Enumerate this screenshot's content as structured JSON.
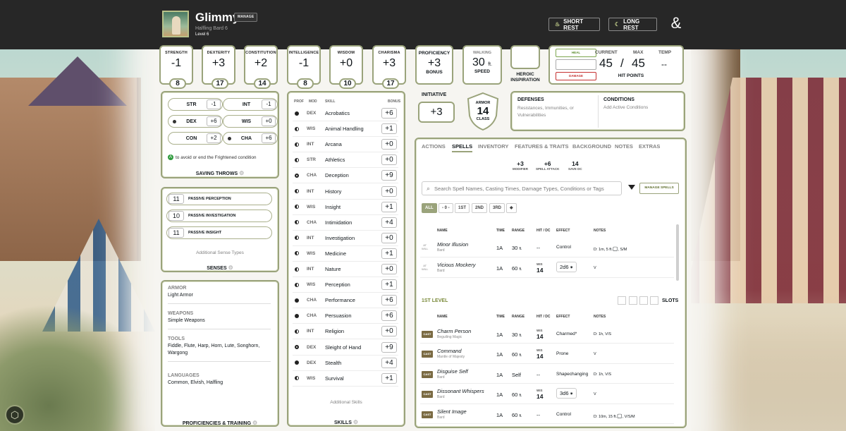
{
  "header": {
    "name": "Glimmy",
    "manage_label": "MANAGE",
    "subtitle": "Halfling  Bard 6",
    "level": "Level 6",
    "short_rest": "SHORT REST",
    "long_rest": "LONG REST"
  },
  "abilities": [
    {
      "label": "STRENGTH",
      "mod": "-1",
      "score": "8"
    },
    {
      "label": "DEXTERITY",
      "mod": "+3",
      "score": "17"
    },
    {
      "label": "CONSTITUTION",
      "mod": "+2",
      "score": "14"
    },
    {
      "label": "INTELLIGENCE",
      "mod": "-1",
      "score": "8"
    },
    {
      "label": "WISDOM",
      "mod": "+0",
      "score": "10"
    },
    {
      "label": "CHARISMA",
      "mod": "+3",
      "score": "17"
    }
  ],
  "proficiency": {
    "title": "PROFICIENCY",
    "value": "+3",
    "sub": "BONUS"
  },
  "speed": {
    "title": "WALKING",
    "value": "30",
    "unit": "ft.",
    "sub": "SPEED"
  },
  "inspiration": {
    "label1": "HEROIC",
    "label2": "INSPIRATION"
  },
  "hp": {
    "heal": "HEAL",
    "damage": "DAMAGE",
    "current_label": "CURRENT",
    "max_label": "MAX",
    "temp_label": "TEMP",
    "current": "45",
    "slash": "/",
    "max": "45",
    "temp": "--",
    "footer": "HIT POINTS"
  },
  "initiative": {
    "title": "INITIATIVE",
    "value": "+3"
  },
  "armor": {
    "top": "ARMOR",
    "value": "14",
    "bottom": "CLASS"
  },
  "defenses": {
    "title": "DEFENSES",
    "text": "Resistances, Immunities, or Vulnerabilities"
  },
  "conditions": {
    "title": "CONDITIONS",
    "text": "Add Active Conditions"
  },
  "saves": {
    "items": [
      {
        "ab": "STR",
        "val": "-1",
        "prof": false
      },
      {
        "ab": "INT",
        "val": "-1",
        "prof": false
      },
      {
        "ab": "DEX",
        "val": "+6",
        "prof": true
      },
      {
        "ab": "WIS",
        "val": "+0",
        "prof": false
      },
      {
        "ab": "CON",
        "val": "+2",
        "prof": false
      },
      {
        "ab": "CHA",
        "val": "+6",
        "prof": true
      }
    ],
    "note_icon": "A",
    "note": "to avoid or end the Frightened condition",
    "title": "SAVING THROWS"
  },
  "senses": {
    "items": [
      {
        "num": "11",
        "label": "PASSIVE PERCEPTION"
      },
      {
        "num": "10",
        "label": "PASSIVE INVESTIGATION"
      },
      {
        "num": "11",
        "label": "PASSIVE INSIGHT"
      }
    ],
    "additional": "Additional Sense Types",
    "title": "SENSES"
  },
  "proficiencies": {
    "sections": [
      {
        "h": "ARMOR",
        "t": "Light Armor"
      },
      {
        "h": "WEAPONS",
        "t": "Simple Weapons"
      },
      {
        "h": "TOOLS",
        "t": "Fiddle, Flute, Harp, Horn, Lute, Songhorn, Wargong"
      },
      {
        "h": "LANGUAGES",
        "t": "Common, Elvish, Halfling"
      }
    ],
    "title": "PROFICIENCIES & TRAINING"
  },
  "skills": {
    "headers": {
      "prof": "PROF",
      "mod": "MOD",
      "skill": "SKILL",
      "bonus": "BONUS"
    },
    "items": [
      {
        "prof": "full",
        "mod": "DEX",
        "name": "Acrobatics",
        "bonus": "+6"
      },
      {
        "prof": "half",
        "mod": "WIS",
        "name": "Animal Handling",
        "bonus": "+1"
      },
      {
        "prof": "half",
        "mod": "INT",
        "name": "Arcana",
        "bonus": "+0"
      },
      {
        "prof": "half",
        "mod": "STR",
        "name": "Athletics",
        "bonus": "+0"
      },
      {
        "prof": "exp",
        "mod": "CHA",
        "name": "Deception",
        "bonus": "+9"
      },
      {
        "prof": "half",
        "mod": "INT",
        "name": "History",
        "bonus": "+0"
      },
      {
        "prof": "half",
        "mod": "WIS",
        "name": "Insight",
        "bonus": "+1"
      },
      {
        "prof": "half",
        "mod": "CHA",
        "name": "Intimidation",
        "bonus": "+4"
      },
      {
        "prof": "half",
        "mod": "INT",
        "name": "Investigation",
        "bonus": "+0"
      },
      {
        "prof": "half",
        "mod": "WIS",
        "name": "Medicine",
        "bonus": "+1"
      },
      {
        "prof": "half",
        "mod": "INT",
        "name": "Nature",
        "bonus": "+0"
      },
      {
        "prof": "half",
        "mod": "WIS",
        "name": "Perception",
        "bonus": "+1"
      },
      {
        "prof": "full",
        "mod": "CHA",
        "name": "Performance",
        "bonus": "+6"
      },
      {
        "prof": "full",
        "mod": "CHA",
        "name": "Persuasion",
        "bonus": "+6"
      },
      {
        "prof": "half",
        "mod": "INT",
        "name": "Religion",
        "bonus": "+0"
      },
      {
        "prof": "exp",
        "mod": "DEX",
        "name": "Sleight of Hand",
        "bonus": "+9"
      },
      {
        "prof": "full",
        "mod": "DEX",
        "name": "Stealth",
        "bonus": "+4"
      },
      {
        "prof": "half",
        "mod": "WIS",
        "name": "Survival",
        "bonus": "+1"
      }
    ],
    "additional": "Additional Skills",
    "title": "SKILLS"
  },
  "tabs": [
    "ACTIONS",
    "SPELLS",
    "INVENTORY",
    "FEATURES & TRAITS",
    "BACKGROUND",
    "NOTES",
    "EXTRAS"
  ],
  "spell_stats": [
    {
      "v": "+3",
      "l": "MODIFIER"
    },
    {
      "v": "+6",
      "l": "SPELL ATTACK"
    },
    {
      "v": "14",
      "l": "SAVE DC"
    }
  ],
  "search": {
    "placeholder": "Search Spell Names, Casting Times, Damage Types, Conditions or Tags"
  },
  "manage_spells": "MANAGE SPELLS",
  "levels": [
    "ALL",
    "- 0 -",
    "1ST",
    "2ND",
    "3RD",
    "◆"
  ],
  "spell_headers": {
    "name": "NAME",
    "time": "TIME",
    "range": "RANGE",
    "hit": "HIT / DC",
    "effect": "EFFECT",
    "notes": "NOTES"
  },
  "cantrips": [
    {
      "tag1": "AT",
      "tag2": "WILL",
      "name": "Minor Illusion",
      "src": "Bard",
      "time": "1A",
      "range": "30",
      "unit": "ft.",
      "hit_label": "",
      "hit": "--",
      "effect": "Control",
      "notes": "D: 1m, 5 ft.",
      "notes2": ", S/M"
    },
    {
      "tag1": "AT",
      "tag2": "WILL",
      "name": "Vicious Mockery",
      "src": "Bard",
      "time": "1A",
      "range": "60",
      "unit": "ft.",
      "hit_label": "WIS",
      "hit": "14",
      "effect": "2d6",
      "notes": "V",
      "notes2": ""
    }
  ],
  "first_level": {
    "title": "1ST LEVEL",
    "slots_label": "SLOTS"
  },
  "level1": [
    {
      "name": "Charm Person",
      "src": "Beguiling Magic",
      "time": "1A",
      "range": "30",
      "unit": "ft.",
      "hit_label": "WIS",
      "hit": "14",
      "effect": "Charmed*",
      "notes": "D: 1h, V/S"
    },
    {
      "name": "Command",
      "src": "Mantle of Majesty",
      "time": "1A",
      "range": "60",
      "unit": "ft.",
      "hit_label": "WIS",
      "hit": "14",
      "effect": "Prone",
      "notes": "V"
    },
    {
      "name": "Disguise Self",
      "src": "Bard",
      "time": "1A",
      "range": "Self",
      "unit": "",
      "hit_label": "",
      "hit": "--",
      "effect": "Shapechanging",
      "notes": "D: 1h, V/S"
    },
    {
      "name": "Dissonant Whispers",
      "src": "Bard",
      "time": "1A",
      "range": "60",
      "unit": "ft.",
      "hit_label": "WIS",
      "hit": "14",
      "effect": "3d6",
      "notes": "V"
    },
    {
      "name": "Silent Image",
      "src": "Bard",
      "time": "1A",
      "range": "60",
      "unit": "ft.",
      "hit_label": "",
      "hit": "--",
      "effect": "Control",
      "notes": "D: 10m, 15 ft.",
      "notes2": ", V/S/M"
    }
  ],
  "cast_label": "CAST",
  "icons": [
    "campfire-icon",
    "moon-icon",
    "dragon-ampersand-icon",
    "gear-icon",
    "filter-icon",
    "d20-icon",
    "cube-icon",
    "damage-icon"
  ]
}
